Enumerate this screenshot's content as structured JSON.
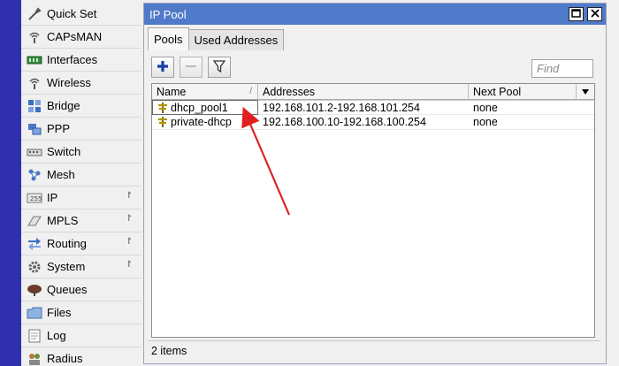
{
  "sidebar": {
    "items": [
      {
        "label": "Quick Set",
        "icon": "quick-set-icon",
        "submenu": false
      },
      {
        "label": "CAPsMAN",
        "icon": "capsman-icon",
        "submenu": false
      },
      {
        "label": "Interfaces",
        "icon": "interfaces-icon",
        "submenu": false
      },
      {
        "label": "Wireless",
        "icon": "wireless-icon",
        "submenu": false
      },
      {
        "label": "Bridge",
        "icon": "bridge-icon",
        "submenu": false
      },
      {
        "label": "PPP",
        "icon": "ppp-icon",
        "submenu": false
      },
      {
        "label": "Switch",
        "icon": "switch-icon",
        "submenu": false
      },
      {
        "label": "Mesh",
        "icon": "mesh-icon",
        "submenu": false
      },
      {
        "label": "IP",
        "icon": "ip-icon",
        "submenu": true
      },
      {
        "label": "MPLS",
        "icon": "mpls-icon",
        "submenu": true
      },
      {
        "label": "Routing",
        "icon": "routing-icon",
        "submenu": true
      },
      {
        "label": "System",
        "icon": "system-icon",
        "submenu": true
      },
      {
        "label": "Queues",
        "icon": "queues-icon",
        "submenu": false
      },
      {
        "label": "Files",
        "icon": "files-icon",
        "submenu": false
      },
      {
        "label": "Log",
        "icon": "log-icon",
        "submenu": false
      },
      {
        "label": "Radius",
        "icon": "radius-icon",
        "submenu": false
      }
    ],
    "submenu_glyph": "↾"
  },
  "window": {
    "title": "IP Pool",
    "tabs": [
      {
        "label": "Pools",
        "active": true
      },
      {
        "label": "Used Addresses",
        "active": false
      }
    ],
    "find_placeholder": "Find",
    "columns": {
      "name": "Name",
      "sort_mark": "/",
      "addresses": "Addresses",
      "next_pool": "Next Pool"
    },
    "rows": [
      {
        "name": "dhcp_pool1",
        "addresses": "192.168.101.2-192.168.101.254",
        "next_pool": "none",
        "selected": true
      },
      {
        "name": "private-dhcp",
        "addresses": "192.168.100.10-192.168.100.254",
        "next_pool": "none",
        "selected": false
      }
    ],
    "status": "2 items"
  },
  "colors": {
    "titlebar": "#4f7ac9",
    "left_strip": "#2f2fb0",
    "add_icon": "#1a3fa8",
    "arrow": "#e02020"
  }
}
